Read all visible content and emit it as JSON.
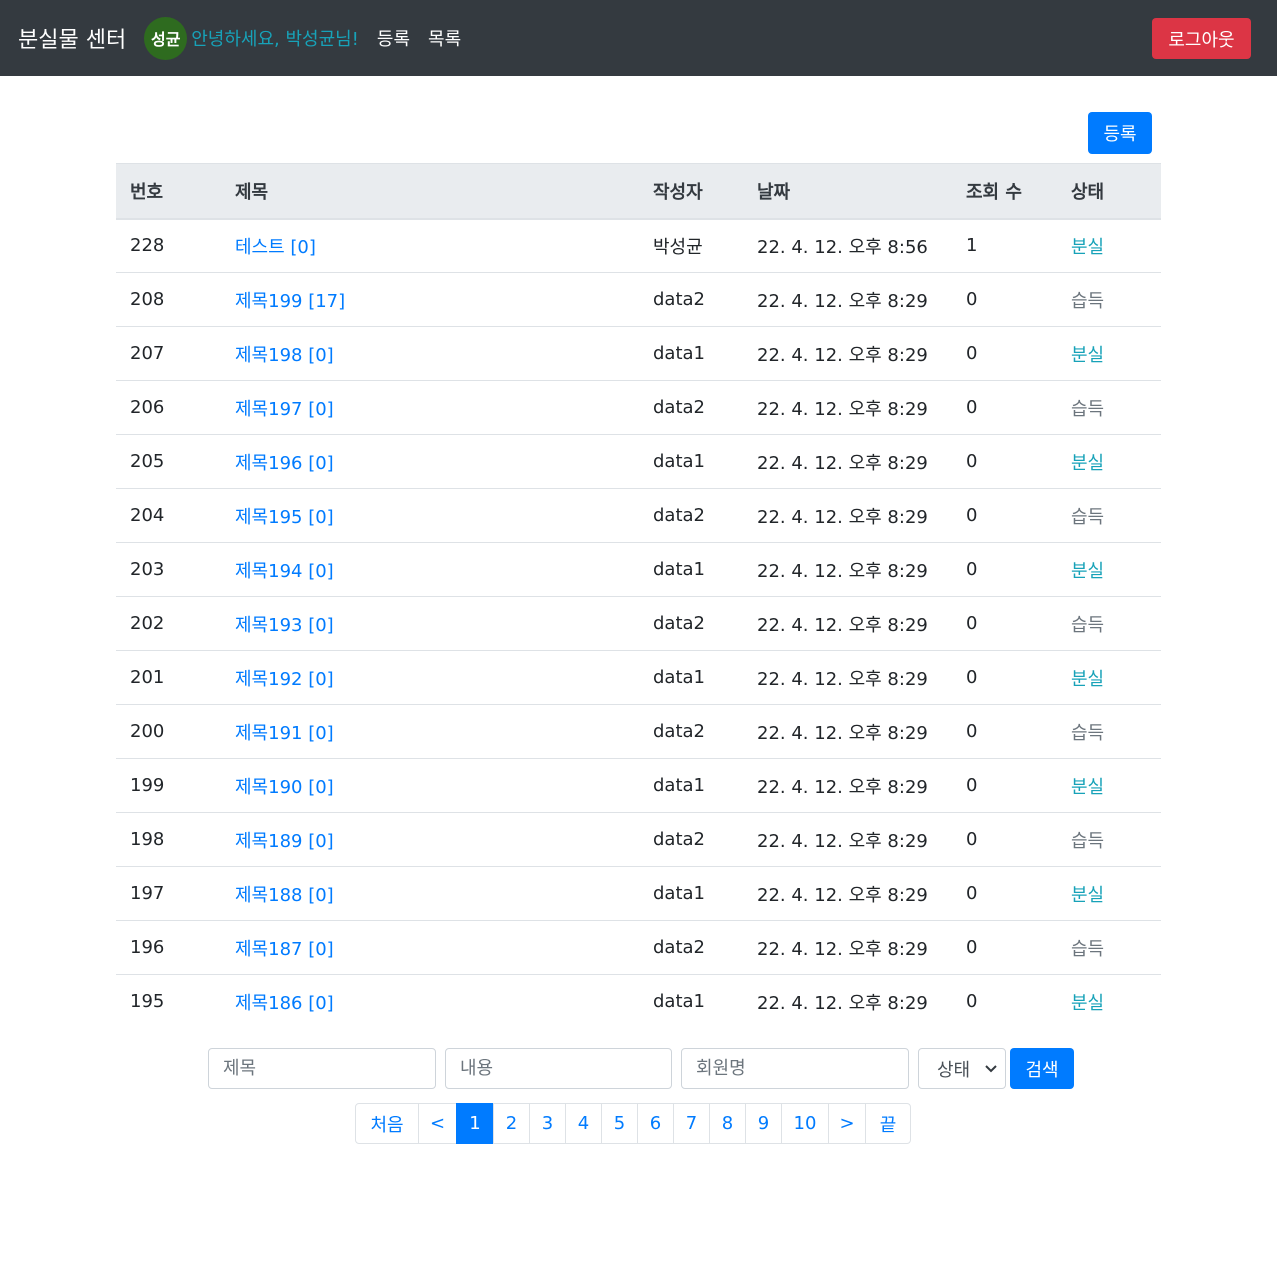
{
  "navbar": {
    "brand": "분실물 센터",
    "avatar_text": "성균",
    "greeting": "안녕하세요, 박성균님!",
    "links": [
      "등록",
      "목록"
    ],
    "logout_label": "로그아웃"
  },
  "toolbar": {
    "register_label": "등록"
  },
  "table": {
    "headers": [
      "번호",
      "제목",
      "작성자",
      "날짜",
      "조회 수",
      "상태"
    ],
    "rows": [
      {
        "no": "228",
        "title": "테스트 [0]",
        "writer": "박성균",
        "date": "22. 4. 12. 오후 8:56",
        "views": "1",
        "status": "분실"
      },
      {
        "no": "208",
        "title": "제목199 [17]",
        "writer": "data2",
        "date": "22. 4. 12. 오후 8:29",
        "views": "0",
        "status": "습득"
      },
      {
        "no": "207",
        "title": "제목198 [0]",
        "writer": "data1",
        "date": "22. 4. 12. 오후 8:29",
        "views": "0",
        "status": "분실"
      },
      {
        "no": "206",
        "title": "제목197 [0]",
        "writer": "data2",
        "date": "22. 4. 12. 오후 8:29",
        "views": "0",
        "status": "습득"
      },
      {
        "no": "205",
        "title": "제목196 [0]",
        "writer": "data1",
        "date": "22. 4. 12. 오후 8:29",
        "views": "0",
        "status": "분실"
      },
      {
        "no": "204",
        "title": "제목195 [0]",
        "writer": "data2",
        "date": "22. 4. 12. 오후 8:29",
        "views": "0",
        "status": "습득"
      },
      {
        "no": "203",
        "title": "제목194 [0]",
        "writer": "data1",
        "date": "22. 4. 12. 오후 8:29",
        "views": "0",
        "status": "분실"
      },
      {
        "no": "202",
        "title": "제목193 [0]",
        "writer": "data2",
        "date": "22. 4. 12. 오후 8:29",
        "views": "0",
        "status": "습득"
      },
      {
        "no": "201",
        "title": "제목192 [0]",
        "writer": "data1",
        "date": "22. 4. 12. 오후 8:29",
        "views": "0",
        "status": "분실"
      },
      {
        "no": "200",
        "title": "제목191 [0]",
        "writer": "data2",
        "date": "22. 4. 12. 오후 8:29",
        "views": "0",
        "status": "습득"
      },
      {
        "no": "199",
        "title": "제목190 [0]",
        "writer": "data1",
        "date": "22. 4. 12. 오후 8:29",
        "views": "0",
        "status": "분실"
      },
      {
        "no": "198",
        "title": "제목189 [0]",
        "writer": "data2",
        "date": "22. 4. 12. 오후 8:29",
        "views": "0",
        "status": "습득"
      },
      {
        "no": "197",
        "title": "제목188 [0]",
        "writer": "data1",
        "date": "22. 4. 12. 오후 8:29",
        "views": "0",
        "status": "분실"
      },
      {
        "no": "196",
        "title": "제목187 [0]",
        "writer": "data2",
        "date": "22. 4. 12. 오후 8:29",
        "views": "0",
        "status": "습득"
      },
      {
        "no": "195",
        "title": "제목186 [0]",
        "writer": "data1",
        "date": "22. 4. 12. 오후 8:29",
        "views": "0",
        "status": "분실"
      }
    ]
  },
  "search": {
    "title_placeholder": "제목",
    "content_placeholder": "내용",
    "member_placeholder": "회원명",
    "status_selected": "상태",
    "button_label": "검색"
  },
  "pagination": {
    "items": [
      "처음",
      "<",
      "1",
      "2",
      "3",
      "4",
      "5",
      "6",
      "7",
      "8",
      "9",
      "10",
      ">",
      "끝"
    ],
    "active": "1"
  },
  "colors": {
    "navbar_bg": "#343a40",
    "primary": "#007bff",
    "danger": "#dc3545",
    "info": "#17a2b8",
    "muted": "#6c757d",
    "avatar_bg": "#2e6b1f"
  }
}
